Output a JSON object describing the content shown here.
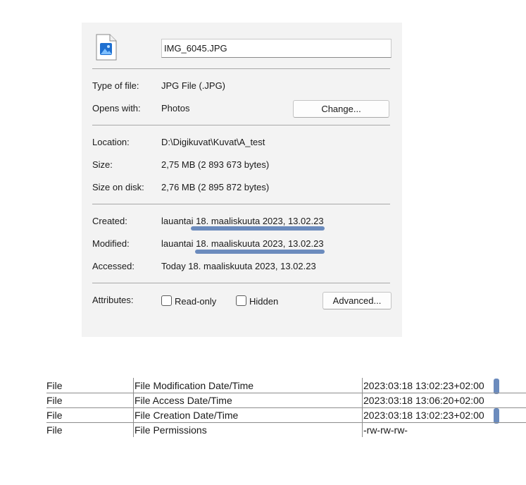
{
  "dialog": {
    "filename": "IMG_6045.JPG",
    "type_label": "Type of file:",
    "type_value": "JPG File (.JPG)",
    "opens_label": "Opens with:",
    "opens_value": "Photos",
    "change_button": "Change...",
    "location_label": "Location:",
    "location_value": "D:\\Digikuvat\\Kuvat\\A_test",
    "size_label": "Size:",
    "size_value": "2,75 MB (2 893 673 bytes)",
    "size_disk_label": "Size on disk:",
    "size_disk_value": "2,76 MB (2 895 872 bytes)",
    "created_label": "Created:",
    "created_value": "lauantai 18. maaliskuuta 2023, 13.02.23",
    "modified_label": "Modified:",
    "modified_value": "lauantai 18. maaliskuuta 2023, 13.02.23",
    "accessed_label": "Accessed:",
    "accessed_value": "Today 18. maaliskuuta 2023, 13.02.23",
    "attributes_label": "Attributes:",
    "readonly_label": "Read-only",
    "hidden_label": "Hidden",
    "advanced_button": "Advanced...",
    "highlight_color": "#6b8bbd"
  },
  "table": {
    "rows": [
      {
        "group": "File",
        "tag": "File Modification Date/Time",
        "value": "2023:03:18 13:02:23+02:00"
      },
      {
        "group": "File",
        "tag": "File Access Date/Time",
        "value": "2023:03:18 13:06:20+02:00"
      },
      {
        "group": "File",
        "tag": "File Creation Date/Time",
        "value": "2023:03:18 13:02:23+02:00"
      },
      {
        "group": "File",
        "tag": "File Permissions",
        "value": "-rw-rw-rw-"
      }
    ]
  }
}
